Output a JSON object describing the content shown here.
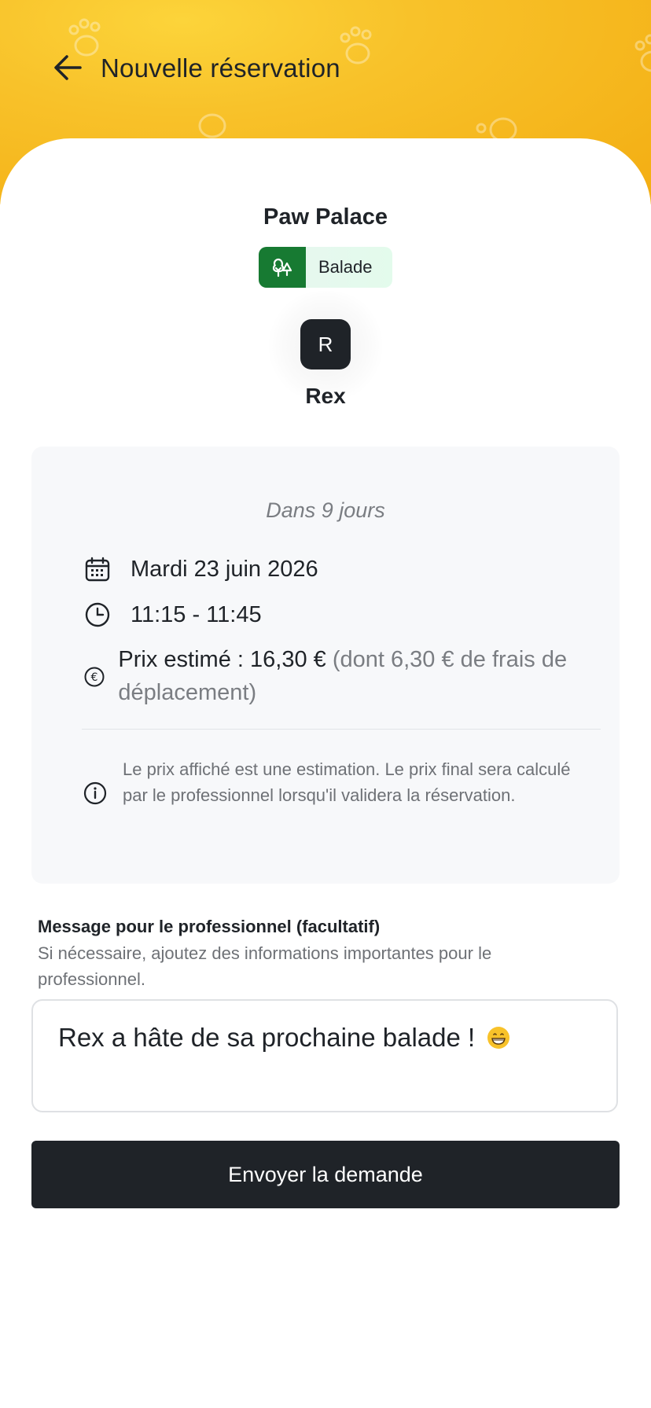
{
  "header": {
    "title": "Nouvelle réservation",
    "back_icon": "arrow-left-icon",
    "background_color": "#f8c22a"
  },
  "provider": {
    "name": "Paw Palace",
    "service": {
      "label": "Balade",
      "icon": "tree-icon",
      "icon_bg_color": "#177a32"
    }
  },
  "pet": {
    "initial": "R",
    "name": "Rex"
  },
  "booking": {
    "relative_date": "Dans 9 jours",
    "date": "Mardi 23 juin 2026",
    "time": "11:15 - 11:45",
    "price_label": "Prix estimé : 16,30 €",
    "price_detail": "(dont 6,30 € de frais de déplacement)",
    "info_note": "Le prix affiché est une estimation. Le prix final sera calculé par le professionnel lorsqu'il validera la réservation."
  },
  "message": {
    "label": "Message pour le professionnel (facultatif)",
    "hint": "Si nécessaire, ajoutez des informations importantes pour le professionnel.",
    "value": "Rex a hâte de sa prochaine balade !"
  },
  "submit": {
    "label": "Envoyer la demande",
    "color": "#1f2328"
  }
}
